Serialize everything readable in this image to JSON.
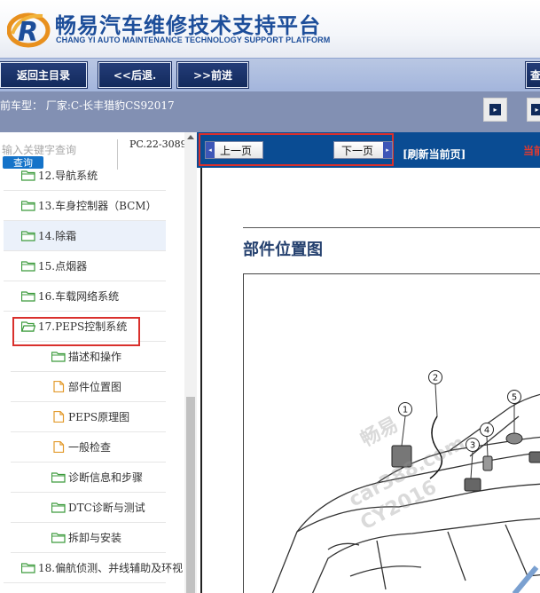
{
  "header": {
    "title_cn": "畅易汽车维修技术支持平台",
    "title_en": "CHANG YI AUTO MAINTENANCE TECHNOLOGY SUPPORT PLATFORM"
  },
  "toolbar": {
    "home_label": "返回主目录",
    "back_label": "<<后退.",
    "forward_label": ">>前进",
    "edge_label": "查"
  },
  "model_bar": {
    "text": "前车型：  厂家:C-长丰猎豹CS92017"
  },
  "search": {
    "placeholder": "输入关键字查询",
    "button_label": "查询",
    "pc_code": "PC.22-3089"
  },
  "tree": {
    "items": [
      {
        "label": "12.导航系统",
        "type": "folder"
      },
      {
        "label": "13.车身控制器（BCM）",
        "type": "folder"
      },
      {
        "label": "14.除霜",
        "type": "folder",
        "selected": true
      },
      {
        "label": "15.点烟器",
        "type": "folder"
      },
      {
        "label": "16.车载网络系统",
        "type": "folder"
      },
      {
        "label": "17.PEPS控制系统",
        "type": "folder-open"
      },
      {
        "label": "描述和操作",
        "type": "folder"
      },
      {
        "label": "部件位置图",
        "type": "doc"
      },
      {
        "label": "PEPS原理图",
        "type": "doc"
      },
      {
        "label": "一般检查",
        "type": "doc"
      },
      {
        "label": "诊断信息和步骤",
        "type": "folder"
      },
      {
        "label": "DTC诊断与测试",
        "type": "folder"
      },
      {
        "label": "拆卸与安装",
        "type": "folder"
      },
      {
        "label": "18.偏航侦测、并线辅助及环视",
        "type": "folder"
      }
    ]
  },
  "content": {
    "prev_label": "上一页",
    "next_label": "下一页",
    "refresh_label": "[刷新当前页]",
    "current_label": "当前",
    "heading": "部件位置图",
    "callouts": [
      "1",
      "2",
      "3",
      "4",
      "5"
    ],
    "watermark_lines": [
      "畅易",
      "car388.com",
      "CY2016"
    ]
  },
  "colors": {
    "brand_blue": "#1d4e9a",
    "toolbar_button": "#132a5c",
    "content_bar": "#0a4c93",
    "highlight_red": "#d9302c",
    "folder_green": "#3c9b3c",
    "doc_orange": "#e39b2d"
  }
}
